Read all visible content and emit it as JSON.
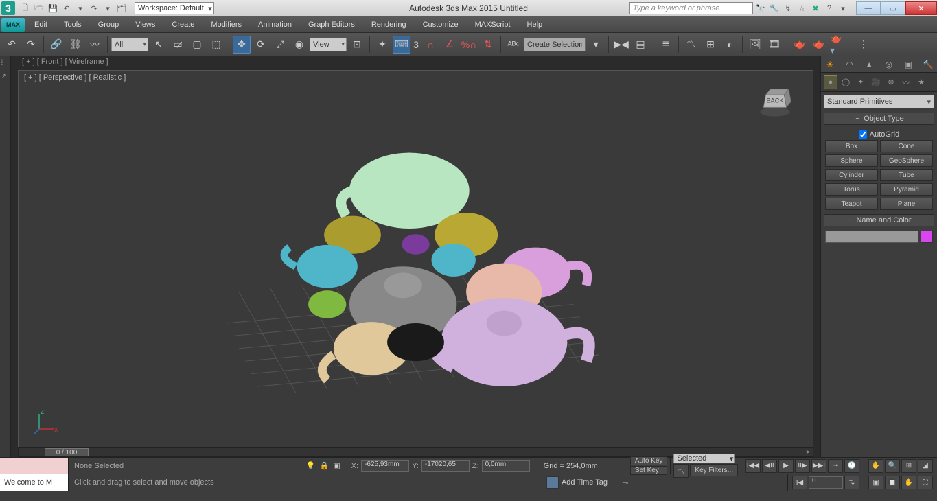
{
  "titlebar": {
    "workspace": "Workspace: Default",
    "app_title": "Autodesk 3ds Max  2015     Untitled",
    "search_placeholder": "Type a keyword or phrase"
  },
  "menu": [
    "Edit",
    "Tools",
    "Group",
    "Views",
    "Create",
    "Modifiers",
    "Animation",
    "Graph Editors",
    "Rendering",
    "Customize",
    "MAXScript",
    "Help"
  ],
  "max_logo": "MAX",
  "toolbar": {
    "filter": "All",
    "coord": "View",
    "spinner_prefix": "3",
    "sel_set_input": "Create Selection Se"
  },
  "viewport": {
    "top_label": "[ + ] [ Front ] [ Wireframe ]",
    "main_label": "[ + ] [ Perspective ] [ Realistic ]",
    "timeline_thumb": "0  / 100",
    "cube_face": "BACK"
  },
  "right_panel": {
    "category": "Standard Primitives",
    "rollout_objtype": "Object Type",
    "autogrid": "AutoGrid",
    "buttons": [
      [
        "Box",
        "Cone"
      ],
      [
        "Sphere",
        "GeoSphere"
      ],
      [
        "Cylinder",
        "Tube"
      ],
      [
        "Torus",
        "Pyramid"
      ],
      [
        "Teapot",
        "Plane"
      ]
    ],
    "rollout_name": "Name and Color"
  },
  "status": {
    "welcome": "Welcome to M",
    "selection": "None Selected",
    "prompt": "Click and drag to select and move objects",
    "x_label": "X:",
    "x_val": "-625,93mm",
    "y_label": "Y:",
    "y_val": "-17020,65",
    "z_label": "Z:",
    "z_val": "0,0mm",
    "grid": "Grid = 254,0mm",
    "autokey": "Auto Key",
    "setkey": "Set Key",
    "selected": "Selected",
    "keyfilters": "Key Filters...",
    "addtimetag": "Add Time Tag",
    "frame_val": "0"
  },
  "colors": {
    "accent": "#1f9e8e",
    "swatch": "#d946ef"
  }
}
